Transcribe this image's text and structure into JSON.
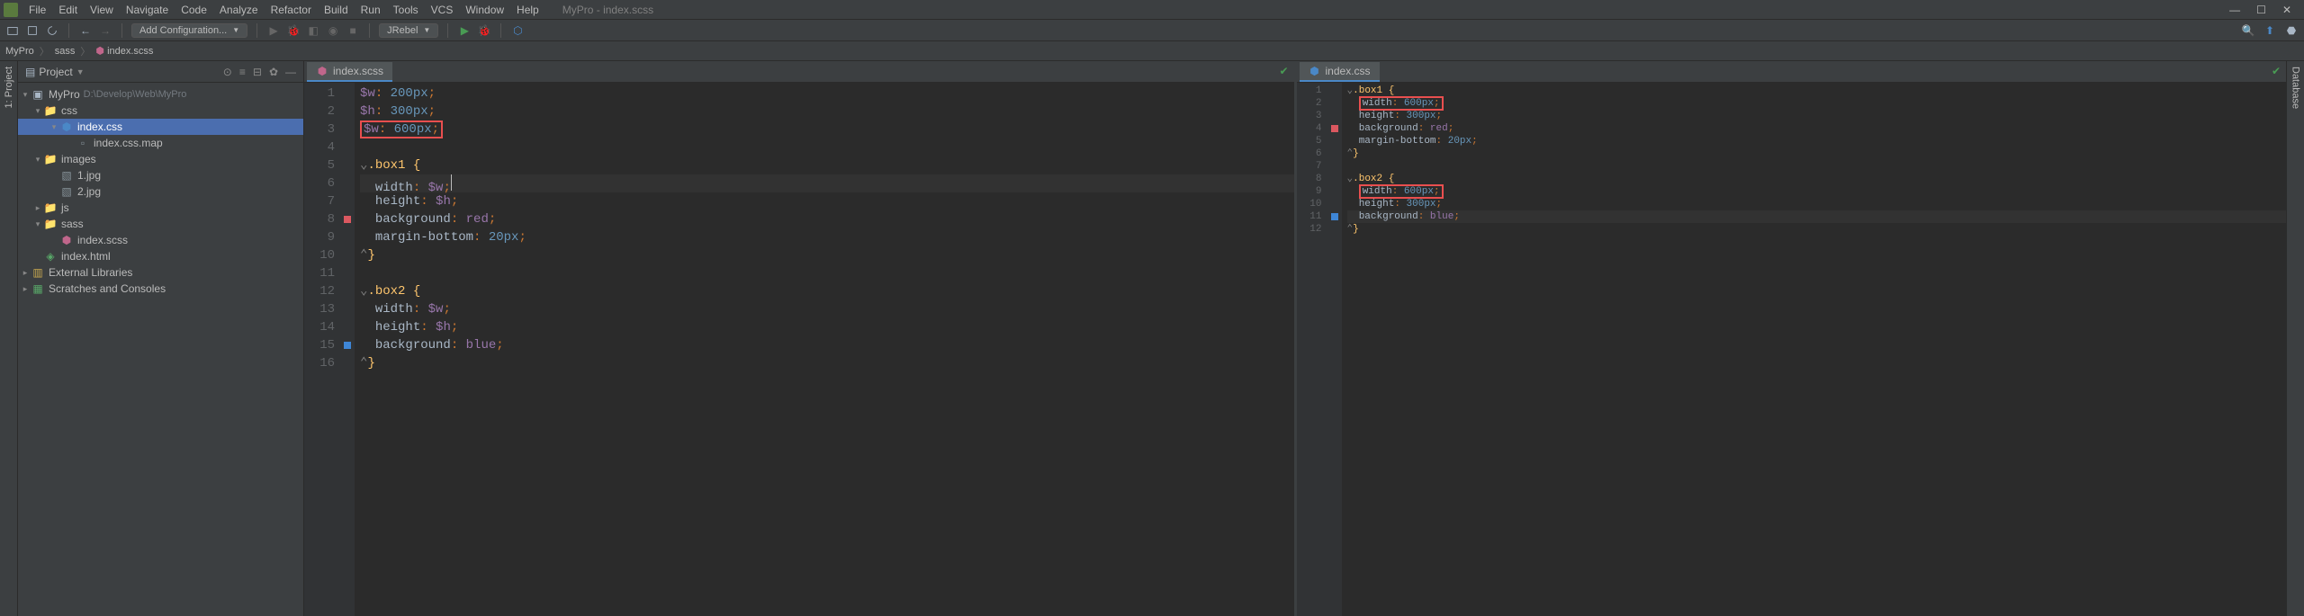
{
  "window": {
    "title": "MyPro - index.scss",
    "controls": {
      "min": "—",
      "max": "☐",
      "close": "✕"
    }
  },
  "menu": [
    "File",
    "Edit",
    "View",
    "Navigate",
    "Code",
    "Analyze",
    "Refactor",
    "Build",
    "Run",
    "Tools",
    "VCS",
    "Window",
    "Help"
  ],
  "toolbar": {
    "run_config": "Add Configuration...",
    "jrebel": "JRebel"
  },
  "breadcrumb": [
    "MyPro",
    "sass",
    "index.scss"
  ],
  "left_tab": "1: Project",
  "right_tab": "Database",
  "project": {
    "title": "Project",
    "root": {
      "label": "MyPro",
      "path": "D:\\Develop\\Web\\MyPro"
    },
    "tree": [
      {
        "ind": 1,
        "arrow": "▾",
        "icon": "folder",
        "label": "css"
      },
      {
        "ind": 2,
        "arrow": "▾",
        "icon": "css",
        "label": "index.css",
        "sel": true
      },
      {
        "ind": 3,
        "arrow": "",
        "icon": "file",
        "label": "index.css.map"
      },
      {
        "ind": 1,
        "arrow": "▾",
        "icon": "folder",
        "label": "images"
      },
      {
        "ind": 2,
        "arrow": "",
        "icon": "img",
        "label": "1.jpg"
      },
      {
        "ind": 2,
        "arrow": "",
        "icon": "img",
        "label": "2.jpg"
      },
      {
        "ind": 1,
        "arrow": "▸",
        "icon": "folder",
        "label": "js"
      },
      {
        "ind": 1,
        "arrow": "▾",
        "icon": "folder",
        "label": "sass"
      },
      {
        "ind": 2,
        "arrow": "",
        "icon": "scss",
        "label": "index.scss"
      },
      {
        "ind": 1,
        "arrow": "",
        "icon": "html",
        "label": "index.html"
      }
    ],
    "external": "External Libraries",
    "scratches": "Scratches and Consoles"
  },
  "editor_left": {
    "tab": "index.scss",
    "lines": 16,
    "code": {
      "l1": {
        "v": "$w",
        "n": "200px"
      },
      "l2": {
        "v": "$h",
        "n": "300px"
      },
      "l3": {
        "v": "$w",
        "n": "600px"
      },
      "l5": ".box1 {",
      "l6": {
        "p": "width",
        "v": "$w"
      },
      "l7": {
        "p": "height",
        "v": "$h"
      },
      "l8": {
        "p": "background",
        "v": "red"
      },
      "l9": {
        "p": "margin-bottom",
        "n": "20px"
      },
      "l10": "}",
      "l12": ".box2 {",
      "l13": {
        "p": "width",
        "v": "$w"
      },
      "l14": {
        "p": "height",
        "v": "$h"
      },
      "l15": {
        "p": "background",
        "v": "blue"
      },
      "l16": "}"
    }
  },
  "editor_right": {
    "tab": "index.css",
    "lines": 12,
    "code": {
      "l1": ".box1 {",
      "l2": {
        "p": "width",
        "n": "600px"
      },
      "l3": {
        "p": "height",
        "n": "300px"
      },
      "l4": {
        "p": "background",
        "v": "red"
      },
      "l5": {
        "p": "margin-bottom",
        "n": "20px"
      },
      "l6": "}",
      "l8": ".box2 {",
      "l9": {
        "p": "width",
        "n": "600px"
      },
      "l10": {
        "p": "height",
        "n": "300px"
      },
      "l11": {
        "p": "background",
        "v": "blue"
      },
      "l12": "}"
    }
  }
}
